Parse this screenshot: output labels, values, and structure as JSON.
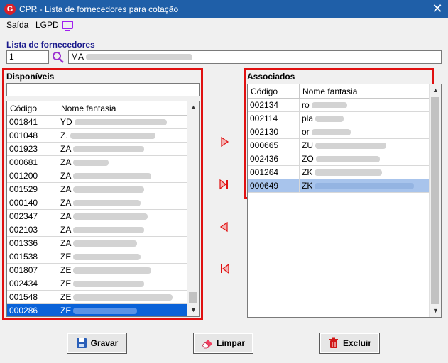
{
  "window": {
    "title": "CPR - Lista de fornecedores para cotação",
    "app_icon": "G",
    "close_glyph": "✕"
  },
  "menu": {
    "items": [
      "Saída",
      "LGPD"
    ]
  },
  "lista": {
    "label": "Lista de fornecedores",
    "code": "1",
    "name_prefix": "MA"
  },
  "disponiveis": {
    "title": "Disponíveis",
    "columns": [
      "Código",
      "Nome fantasia"
    ],
    "rows": [
      {
        "code": "001841",
        "prefix": "YD"
      },
      {
        "code": "001048",
        "prefix": "Z."
      },
      {
        "code": "001923",
        "prefix": "ZA"
      },
      {
        "code": "000681",
        "prefix": "ZA"
      },
      {
        "code": "001200",
        "prefix": "ZA"
      },
      {
        "code": "001529",
        "prefix": "ZA"
      },
      {
        "code": "000140",
        "prefix": "ZA"
      },
      {
        "code": "002347",
        "prefix": "ZA"
      },
      {
        "code": "002103",
        "prefix": "ZA"
      },
      {
        "code": "001336",
        "prefix": "ZA"
      },
      {
        "code": "001538",
        "prefix": "ZE"
      },
      {
        "code": "001807",
        "prefix": "ZE"
      },
      {
        "code": "002434",
        "prefix": "ZE"
      },
      {
        "code": "001548",
        "prefix": "ZE"
      },
      {
        "code": "000286",
        "prefix": "ZE"
      }
    ]
  },
  "associados": {
    "title": "Associados",
    "columns": [
      "Código",
      "Nome fantasia"
    ],
    "rows": [
      {
        "code": "002134",
        "prefix": "ro"
      },
      {
        "code": "002114",
        "prefix": "pla"
      },
      {
        "code": "002130",
        "prefix": "or"
      },
      {
        "code": "000665",
        "prefix": "ZU"
      },
      {
        "code": "002436",
        "prefix": "ZO"
      },
      {
        "code": "001264",
        "prefix": "ZK"
      },
      {
        "code": "000649",
        "prefix": "ZK"
      }
    ]
  },
  "buttons": {
    "gravar": {
      "first": "G",
      "rest": "ravar"
    },
    "limpar": {
      "first": "L",
      "rest": "impar"
    },
    "excluir": {
      "first": "E",
      "rest": "xcluir"
    }
  },
  "colors": {
    "accent_red": "#e01010",
    "title_blue": "#1f5fa8",
    "selection": "#0a62d8",
    "label_blue": "#1a1a8c"
  }
}
